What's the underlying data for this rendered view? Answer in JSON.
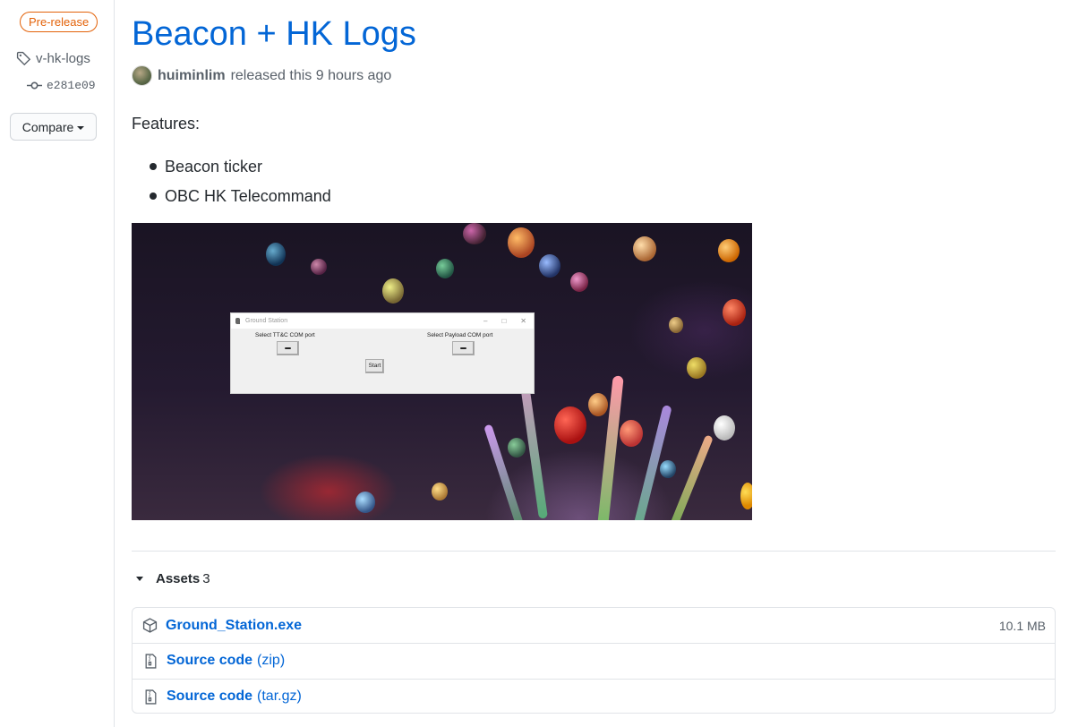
{
  "sidebar": {
    "badge": "Pre-release",
    "tag": "v-hk-logs",
    "commit": "e281e09",
    "compare_label": "Compare"
  },
  "release": {
    "title": "Beacon + HK Logs",
    "author": "huiminlim",
    "released_text": "released this 9 hours ago",
    "features_heading": "Features:",
    "features": [
      "Beacon ticker",
      "OBC HK Telecommand"
    ]
  },
  "screenshot": {
    "window_title": "Ground Station",
    "label_left": "Select TT&C COM port",
    "label_right": "Select Payload COM port",
    "start_label": "Start",
    "window_controls": [
      "–",
      "□",
      "✕"
    ]
  },
  "assets": {
    "label": "Assets",
    "count": "3",
    "items": [
      {
        "name": "Ground_Station.exe",
        "suffix": "",
        "size": "10.1 MB",
        "icon": "package-icon"
      },
      {
        "name": "Source code",
        "suffix": "(zip)",
        "size": "",
        "icon": "file-zip-icon"
      },
      {
        "name": "Source code",
        "suffix": "(tar.gz)",
        "size": "",
        "icon": "file-zip-icon"
      }
    ]
  },
  "colors": {
    "link": "#0366d6",
    "prerelease": "#e36209",
    "muted": "#586069"
  }
}
